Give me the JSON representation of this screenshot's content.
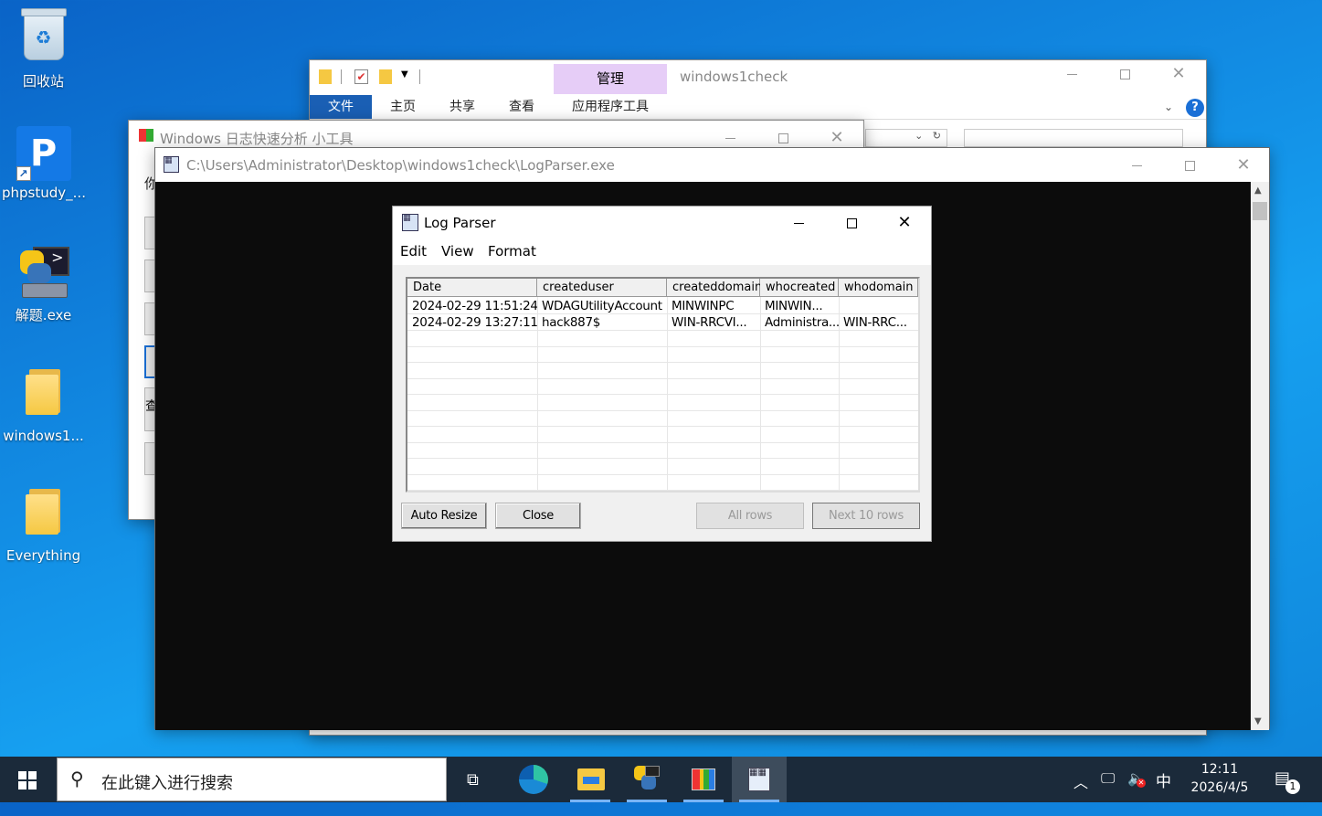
{
  "desktop": {
    "icons": [
      {
        "label": "回收站",
        "icon": "recycle-bin-icon"
      },
      {
        "label": "phpstudy_...",
        "icon": "phpstudy-icon"
      },
      {
        "label": "解题.exe",
        "icon": "python-exe-icon"
      },
      {
        "label": "windows1...",
        "icon": "folder-icon"
      },
      {
        "label": "Everything",
        "icon": "folder-icon"
      }
    ]
  },
  "explorer": {
    "title": "windows1check",
    "context_tab_header": "管理",
    "tabs": [
      "文件",
      "主页",
      "共享",
      "查看",
      "应用程序工具"
    ]
  },
  "tool_window": {
    "title": "Windows 日志快速分析 小工具",
    "partial_label_1": "你",
    "partial_label_2": "查"
  },
  "console": {
    "title": "C:\\Users\\Administrator\\Desktop\\windows1check\\LogParser.exe"
  },
  "logparser": {
    "title": "Log Parser",
    "menu": [
      "Edit",
      "View",
      "Format"
    ],
    "columns": [
      "Date",
      "createduser",
      "createddomain",
      "whocreated",
      "whodomain"
    ],
    "rows": [
      [
        "2024-02-29 11:51:24",
        "WDAGUtilityAccount",
        "MINWINPC",
        "MINWIN...",
        ""
      ],
      [
        "2024-02-29 13:27:11",
        "hack887$",
        "WIN-RRCVI...",
        "Administra...",
        "WIN-RRC..."
      ]
    ],
    "buttons": {
      "auto_resize": "Auto Resize",
      "close": "Close",
      "all_rows": "All rows",
      "next_rows": "Next 10 rows"
    }
  },
  "taskbar": {
    "search_placeholder": "在此键入进行搜索",
    "ime": "中",
    "time": "12:11",
    "date": "2026/4/5",
    "notification_count": "1"
  },
  "colors": {
    "desktop_blue": "#1187e0",
    "ribbon_file_blue": "#1a5fb4",
    "manage_tab_purple": "#e6cdf7",
    "console_black": "#0c0c0c",
    "taskbar": "#1b2a3a"
  }
}
